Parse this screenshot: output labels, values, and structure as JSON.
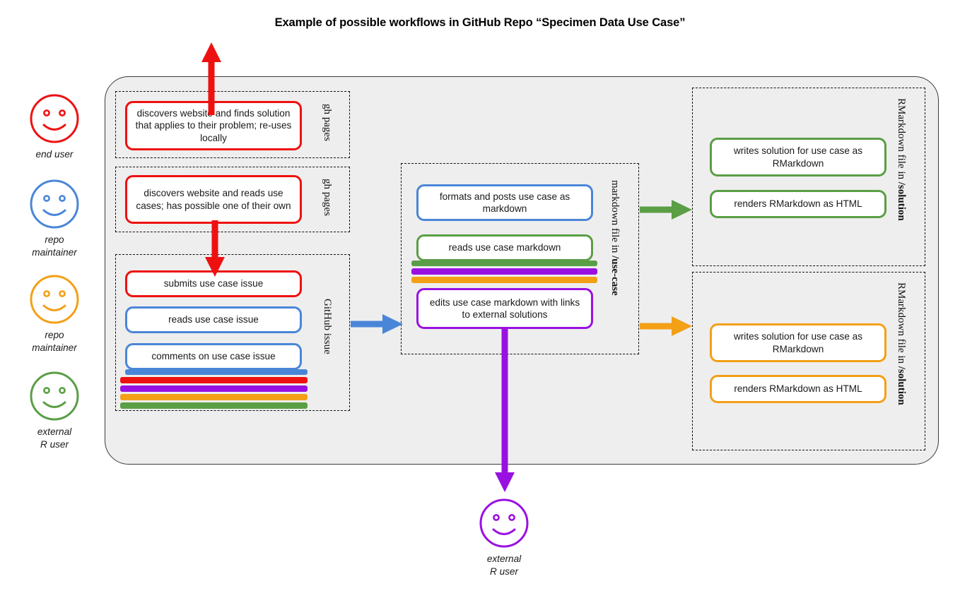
{
  "title": "Example of possible workflows in GitHub Repo “Specimen Data Use Case”",
  "colors": {
    "red": "#ee1111",
    "blue": "#4a86d8",
    "green": "#5a9e45",
    "orange": "#f3a017",
    "purple": "#9911e0",
    "canvas_bg": "#eeeeee",
    "canvas_border": "#3b3b3b",
    "page_bg": "#ffffff"
  },
  "legend": {
    "items": [
      {
        "icon": "smiley-face-icon",
        "color": "#ee1111",
        "label": "end user"
      },
      {
        "icon": "smiley-face-icon",
        "color": "#4a86d8",
        "label": "repo\nmaintainer"
      },
      {
        "icon": "smiley-face-icon",
        "color": "#f3a017",
        "label": "repo\nmaintainer"
      },
      {
        "icon": "smiley-face-icon",
        "color": "#5a9e45",
        "label": "external\nR user"
      }
    ]
  },
  "groups": {
    "gh_pages_1": {
      "label": "gh pages",
      "boxes": [
        {
          "color": "red",
          "text": "discovers website and finds solution that applies to their problem; re-uses locally"
        }
      ]
    },
    "gh_pages_2": {
      "label": "gh pages",
      "boxes": [
        {
          "color": "red",
          "text": "discovers website and reads use cases; has possible one of their own"
        }
      ]
    },
    "github_issue": {
      "label": "GitHub issue",
      "boxes": [
        {
          "color": "red",
          "text": "submits use case issue"
        },
        {
          "color": "blue",
          "text": "reads use case issue"
        },
        {
          "color": "blue",
          "text": "comments on use case issue"
        }
      ],
      "stack_bars": [
        "blue",
        "red",
        "purple",
        "orange",
        "green"
      ]
    },
    "markdown_use_case": {
      "label_plain": "markdown file in ",
      "label_bold": "/use-case",
      "boxes": [
        {
          "color": "blue",
          "text": "formats and posts use case as markdown"
        },
        {
          "color": "green",
          "text": "reads use case markdown"
        },
        {
          "color": "purple",
          "text": "edits use case markdown with links to external solutions"
        }
      ],
      "stack_bars": [
        "purple",
        "orange"
      ]
    },
    "rmarkdown_solution_green": {
      "label_plain": "RMarkdown file in ",
      "label_bold": "/solution",
      "boxes": [
        {
          "color": "green",
          "text": "writes solution for use case as RMarkdown"
        },
        {
          "color": "green",
          "text": "renders RMarkdown as HTML"
        }
      ]
    },
    "rmarkdown_solution_orange": {
      "label_plain": "RMarkdown file in ",
      "label_bold": "/solution",
      "boxes": [
        {
          "color": "orange",
          "text": "writes solution for use case as RMarkdown"
        },
        {
          "color": "orange",
          "text": "renders RMarkdown as HTML"
        }
      ]
    }
  },
  "arrows": [
    {
      "name": "arrow-up-from-gh-pages-1",
      "color": "#ee1111",
      "direction": "up"
    },
    {
      "name": "arrow-down-gh-pages-2-to-github-issue",
      "color": "#ee1111",
      "direction": "down"
    },
    {
      "name": "arrow-right-github-issue-to-markdown",
      "color": "#4a86d8",
      "direction": "right"
    },
    {
      "name": "arrow-right-markdown-to-rmarkdown-green",
      "color": "#5a9e45",
      "direction": "right"
    },
    {
      "name": "arrow-right-markdown-to-rmarkdown-orange",
      "color": "#f3a017",
      "direction": "right"
    },
    {
      "name": "arrow-down-markdown-to-external-r-user",
      "color": "#9911e0",
      "direction": "down"
    }
  ],
  "bottom_actor": {
    "icon": "smiley-face-icon",
    "color": "#9911e0",
    "label": "external\nR user"
  }
}
